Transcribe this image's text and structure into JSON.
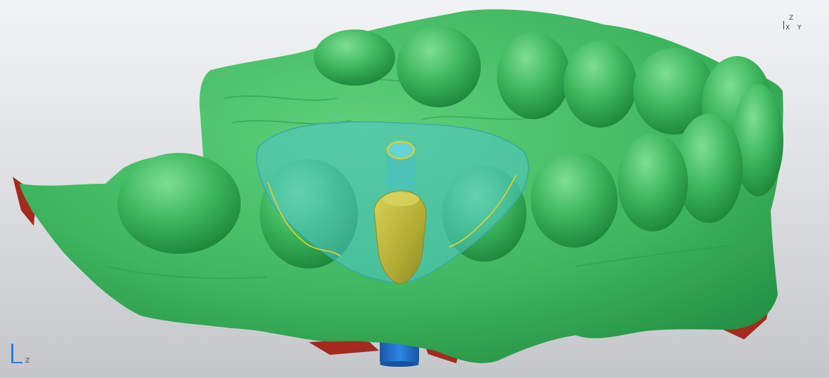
{
  "viewer": {
    "orientation_triad": {
      "up": "Z",
      "center": "X",
      "right": "Y"
    },
    "corner_axes": {
      "label": "Z"
    }
  },
  "colors": {
    "background_top": "#f2f3f4",
    "background_bottom": "#c4c7ca",
    "model_green": "#3fb760",
    "model_green_light": "#5fd07b",
    "model_green_dark": "#238f43",
    "guide_cyan": "#4fc6c9",
    "implant_gold": "#b8b436",
    "margin_line": "#d8d02c",
    "cut_red": "#a32a1e",
    "analog_blue": "#1f6fd0",
    "axis_blue": "#2a7be0"
  },
  "icons": [
    "orientation-triad-icon",
    "corner-axis-icon"
  ]
}
